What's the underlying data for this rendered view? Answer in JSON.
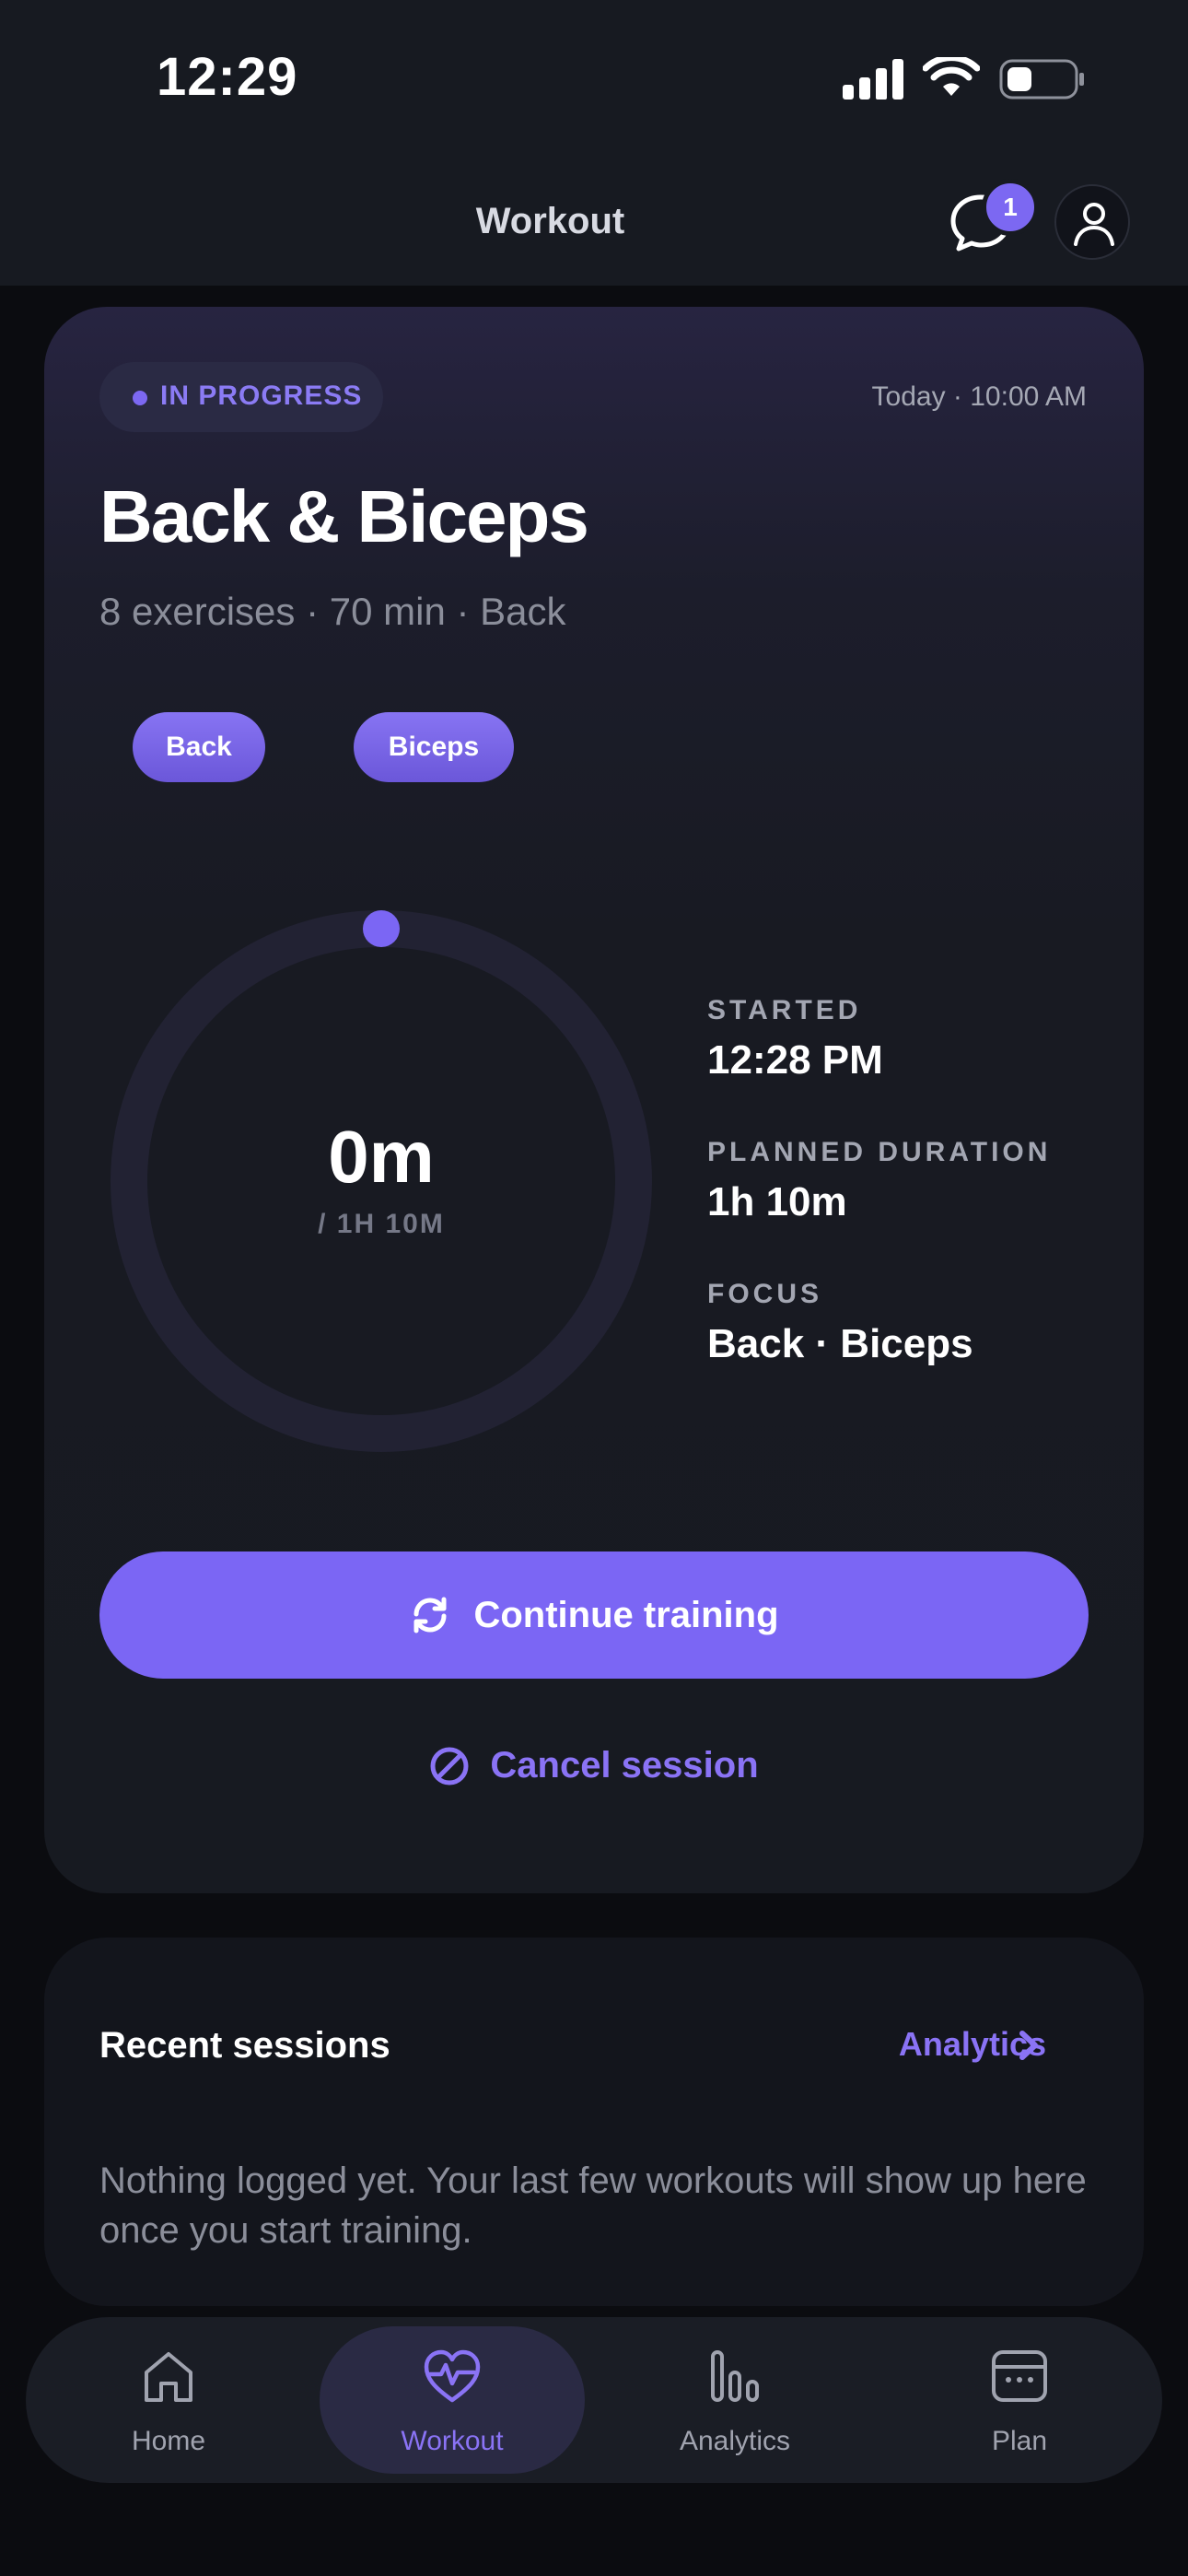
{
  "status_bar": {
    "time": "12:29"
  },
  "header": {
    "title": "Workout",
    "chat_badge": "1"
  },
  "session": {
    "status": "IN PROGRESS",
    "datetime": "Today · 10:00 AM",
    "title": "Back & Biceps",
    "subtitle": "8 exercises · 70 min · Back",
    "tags": [
      "Back",
      "Biceps"
    ],
    "timer": {
      "elapsed": "0m",
      "total": "/ 1H 10M",
      "progress_fraction": 0.0
    },
    "stats": [
      {
        "label": "STARTED",
        "value": "12:28 PM"
      },
      {
        "label": "PLANNED DURATION",
        "value": "1h 10m"
      },
      {
        "label": "FOCUS",
        "value": "Back · Biceps"
      }
    ],
    "continue_label": "Continue training",
    "cancel_label": "Cancel session"
  },
  "recent": {
    "title": "Recent sessions",
    "link_label": "Analytics",
    "empty_text": "Nothing logged yet. Your last few workouts will show up here once you start training."
  },
  "tabs": [
    {
      "label": "Home",
      "icon": "home-icon"
    },
    {
      "label": "Workout",
      "icon": "heart-pulse-icon",
      "active": true
    },
    {
      "label": "Analytics",
      "icon": "bar-chart-icon"
    },
    {
      "label": "Plan",
      "icon": "calendar-icon"
    }
  ],
  "colors": {
    "accent": "#7b66f4",
    "background": "#0b0c10",
    "card": "#171a21"
  }
}
